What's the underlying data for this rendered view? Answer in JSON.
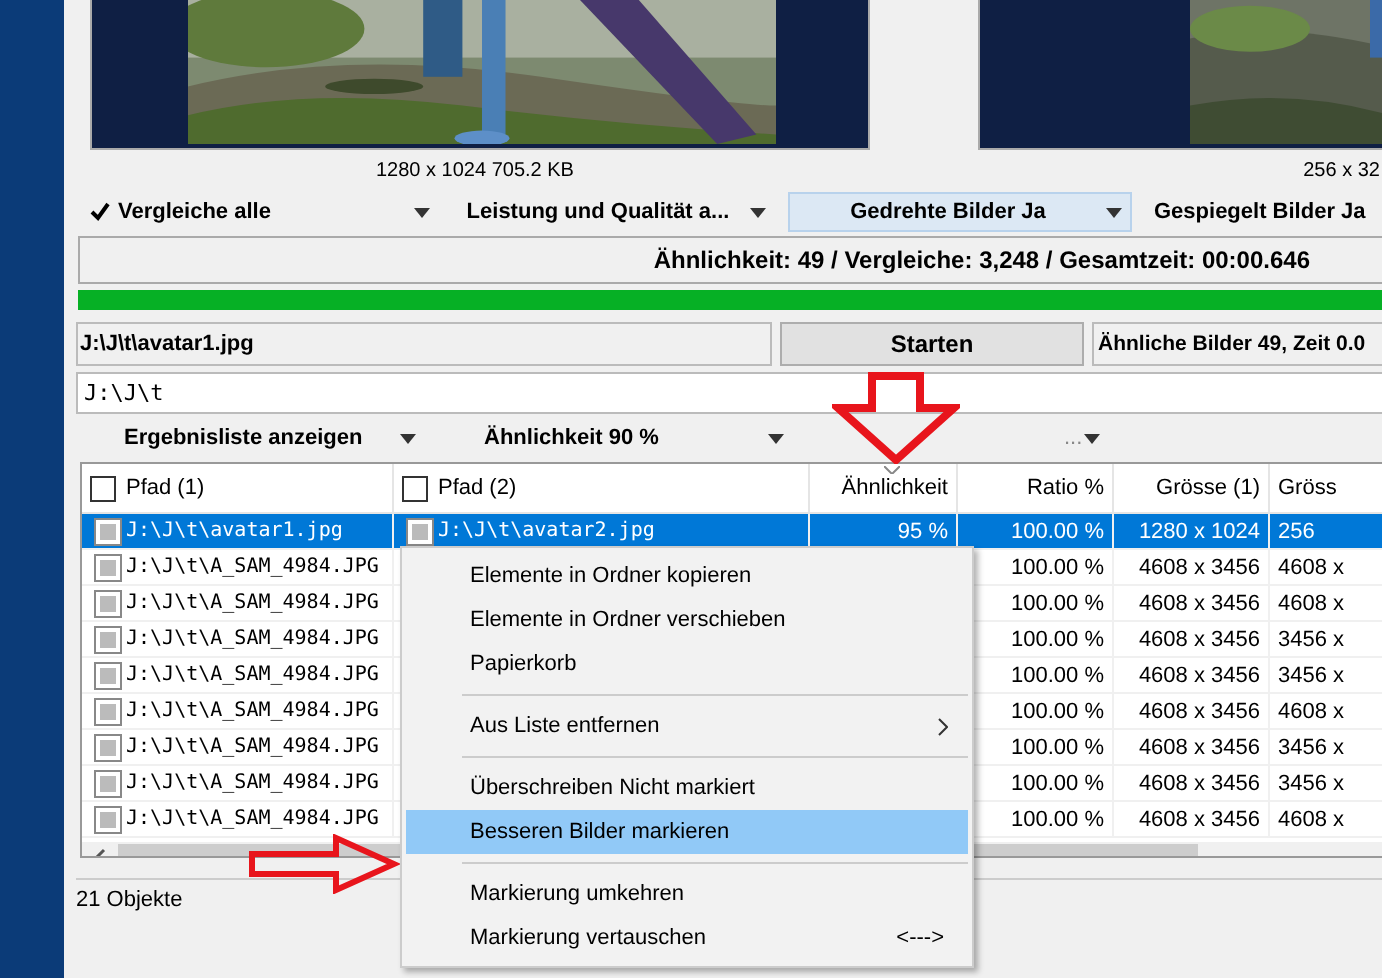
{
  "images": [
    {
      "caption": "1280 x 1024 705.2 KB"
    },
    {
      "caption": "256 x 32"
    }
  ],
  "toolbar": [
    {
      "label": "Vergleiche alle",
      "checked": true,
      "selected": false,
      "dropdown": true
    },
    {
      "label": "Leistung und Qualität a...",
      "checked": false,
      "selected": false,
      "dropdown": true
    },
    {
      "label": "Gedrehte Bilder Ja",
      "checked": false,
      "selected": true,
      "dropdown": true
    },
    {
      "label": "Gespiegelt Bilder Ja",
      "checked": false,
      "selected": false,
      "dropdown": false
    }
  ],
  "summary": {
    "text": "Ähnlichkeit: 49 / Vergleiche: 3,248 / Gesamtzeit: 00:00.646",
    "level": 1
  },
  "file_field": {
    "value": "J:\\J\\t\\avatar1.jpg"
  },
  "start_button": "Starten",
  "result_info": "Ähnliche Bilder 49, Zeit 0.0",
  "path_field": {
    "value": "J:\\J\\t"
  },
  "filters": [
    "Ergebnisliste anzeigen",
    "Ähnlichkeit 90 %",
    "..."
  ],
  "table": {
    "columns": [
      {
        "label": "Pfad (1)",
        "kind": "check",
        "checked": false,
        "sorted": false
      },
      {
        "label": "Pfad (2)",
        "kind": "check",
        "checked": false,
        "sorted": false
      },
      {
        "label": "Ähnlichkeit",
        "kind": "text",
        "sorted": true
      },
      {
        "label": "Ratio %",
        "kind": "text",
        "sorted": false
      },
      {
        "label": "Grösse (1)",
        "kind": "text",
        "sorted": false
      },
      {
        "label": "Gröss",
        "kind": "text",
        "sorted": false
      }
    ],
    "rows": [
      {
        "selected": true,
        "cells": [
          "J:\\J\\t\\avatar1.jpg",
          "J:\\J\\t\\avatar2.jpg",
          "95 %",
          "100.00 %",
          "1280 x 1024",
          "256"
        ]
      },
      {
        "selected": false,
        "cells": [
          "J:\\J\\t\\A_SAM_4984.JPG",
          null,
          null,
          "100.00 %",
          "4608 x 3456",
          "4608 x"
        ]
      },
      {
        "selected": false,
        "cells": [
          "J:\\J\\t\\A_SAM_4984.JPG",
          null,
          null,
          "100.00 %",
          "4608 x 3456",
          "4608 x"
        ]
      },
      {
        "selected": false,
        "cells": [
          "J:\\J\\t\\A_SAM_4984.JPG",
          null,
          null,
          "100.00 %",
          "4608 x 3456",
          "3456 x"
        ]
      },
      {
        "selected": false,
        "cells": [
          "J:\\J\\t\\A_SAM_4984.JPG",
          null,
          null,
          "100.00 %",
          "4608 x 3456",
          "3456 x"
        ]
      },
      {
        "selected": false,
        "cells": [
          "J:\\J\\t\\A_SAM_4984.JPG",
          null,
          null,
          "100.00 %",
          "4608 x 3456",
          "4608 x"
        ]
      },
      {
        "selected": false,
        "cells": [
          "J:\\J\\t\\A_SAM_4984.JPG",
          null,
          null,
          "100.00 %",
          "4608 x 3456",
          "3456 x"
        ]
      },
      {
        "selected": false,
        "cells": [
          "J:\\J\\t\\A_SAM_4984.JPG",
          null,
          null,
          "100.00 %",
          "4608 x 3456",
          "3456 x"
        ]
      },
      {
        "selected": false,
        "cells": [
          "J:\\J\\t\\A_SAM_4984.JPG",
          null,
          null,
          "100.00 %",
          "4608 x 3456",
          "4608 x"
        ]
      }
    ]
  },
  "status_bar": "21 Objekte",
  "context_menu": [
    {
      "kind": "item",
      "label": "Elemente in Ordner kopieren",
      "selected": false
    },
    {
      "kind": "item",
      "label": "Elemente in Ordner verschieben",
      "selected": false
    },
    {
      "kind": "item",
      "label": "Papierkorb",
      "selected": false
    },
    {
      "kind": "separator"
    },
    {
      "kind": "item",
      "label": "Aus Liste entfernen",
      "selected": false,
      "submenu": true
    },
    {
      "kind": "separator"
    },
    {
      "kind": "item",
      "label": "Überschreiben Nicht markiert",
      "selected": false
    },
    {
      "kind": "item",
      "label": "Besseren Bilder markieren",
      "selected": true
    },
    {
      "kind": "separator"
    },
    {
      "kind": "item",
      "label": "Markierung umkehren",
      "selected": false
    },
    {
      "kind": "item",
      "label": "Markierung vertauschen",
      "selected": false,
      "shortcut": "<--->"
    }
  ]
}
